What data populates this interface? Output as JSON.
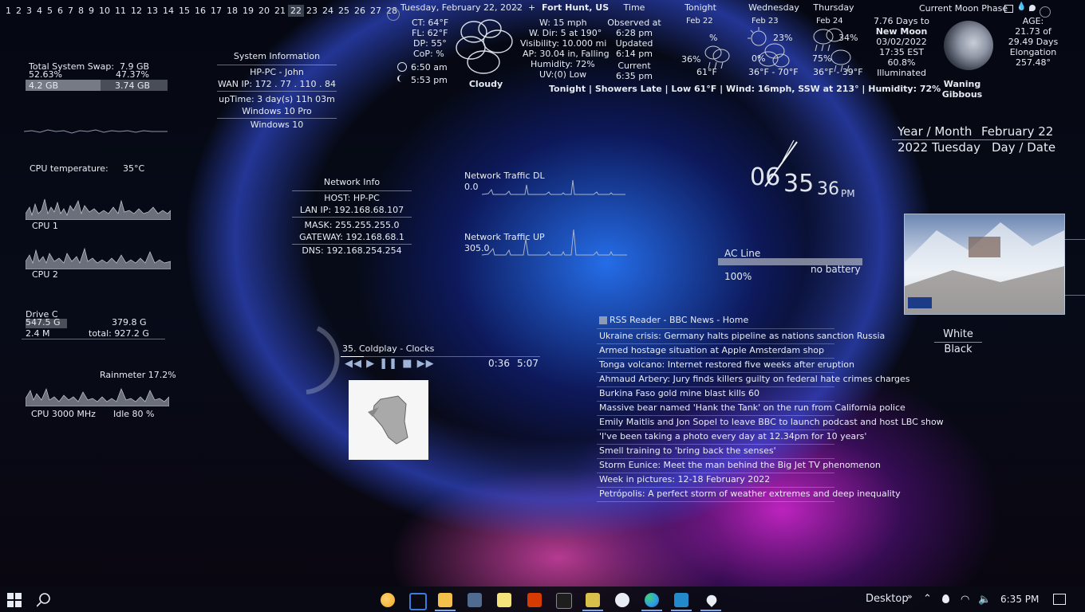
{
  "calendar": {
    "days": [
      "1",
      "2",
      "3",
      "4",
      "5",
      "6",
      "7",
      "8",
      "9",
      "10",
      "11",
      "12",
      "13",
      "14",
      "15",
      "16",
      "17",
      "18",
      "19",
      "20",
      "21",
      "22",
      "23",
      "24",
      "25",
      "26",
      "27",
      "28"
    ],
    "current_index": 21
  },
  "swap": {
    "title": "Total System Swap:",
    "total": "7.9 GB",
    "used_pct": "52.63%",
    "free_pct": "47.37%",
    "used_gb": "4.2 GB",
    "free_gb": "3.74 GB",
    "used_fraction": 0.526
  },
  "sysinfo": {
    "title": "System Information",
    "user": "HP-PC - John",
    "wan_ip": "WAN IP: 172 . 77 . 110 . 84",
    "uptime": "upTime: 3 day(s) 11h 03m",
    "os1": "Windows 10 Pro",
    "os2": "Windows 10"
  },
  "cpu": {
    "temp_label": "CPU temperature:",
    "temp_value": "35°C",
    "cpu1": "CPU 1",
    "cpu2": "CPU 2",
    "rainmeter": "Rainmeter 17.2%",
    "freq": "CPU 3000 MHz",
    "idle": "Idle 80 %"
  },
  "drive": {
    "name": "Drive C",
    "used": "547.5 G",
    "free": "379.8 G",
    "io": "2.4 M",
    "total": "total: 927.2 G",
    "used_fraction": 0.59
  },
  "network": {
    "title": "Network Info",
    "host": "HOST: HP-PC",
    "lan": "LAN IP: 192.168.68.107",
    "mask": "MASK: 255.255.255.0",
    "gateway": "GATEWAY: 192.168.68.1",
    "dns": "DNS: 192.168.254.254"
  },
  "traffic": {
    "dl_title": "Network Traffic DL",
    "dl_value": "0.0",
    "up_title": "Network Traffic UP",
    "up_value": "305.0"
  },
  "media": {
    "track": "35. Coldplay - Clocks",
    "position": "0:36",
    "duration": "5:07",
    "progress_fraction": 0.117
  },
  "weather": {
    "date": "Tuesday, February 22, 2022",
    "minus": "-",
    "plus": "+",
    "location": "Fort Hunt, US",
    "ct": "CT: 64°F",
    "fl": "FL: 62°F",
    "dp": "DP: 55°",
    "cop": "CoP: %",
    "sunrise": "6:50 am",
    "sunset": "5:53 pm",
    "condition": "Cloudy",
    "wind": "W: 15 mph",
    "wdir": "W. Dir: 5 at 190°",
    "visibility": "Visibility: 10.000 mi",
    "ap": "AP: 30.04 in, Falling",
    "humidity": "Humidity: 72%",
    "uv": "UV:(0) Low",
    "time_title": "Time",
    "observed": "Observed at",
    "observed_time": "6:28 pm",
    "updated": "Updated",
    "updated_time": "6:14 pm",
    "current": "Current",
    "current_time": "6:35 pm",
    "summary": "Tonight | Showers Late | Low 61°F | Wind: 16mph, SSW at 213° | Humidity: 72%"
  },
  "forecast": [
    {
      "title": "Tonight",
      "date": "Feb 22",
      "pct": "%",
      "pct2": "36%",
      "temp": "61°F"
    },
    {
      "title": "Wednesday",
      "date": "Feb 23",
      "pct": "23%",
      "pct2": "0%",
      "temp": "36°F - 70°F"
    },
    {
      "title": "Thursday",
      "date": "Feb 24",
      "pct": "34%",
      "pct2": "75%",
      "temp": "36°F - 39°F"
    }
  ],
  "moon": {
    "title": "Current Moon Phase",
    "days_to": "7.76 Days to",
    "next": "New Moon",
    "date": "03/02/2022",
    "time": "17:35 EST",
    "illum": "60.8%",
    "illum_label": "Illuminated",
    "age_label": "AGE:",
    "age": "21.73 of",
    "cycle": "29.49 Days",
    "elong_label": "Elongation",
    "elong": "257.48°",
    "phase": "Waning Gibbous"
  },
  "datebox": {
    "yearmonth_label": "Year / Month",
    "month_day": "February 22",
    "year_weekday": "2022 Tuesday",
    "daydate_label": "Day / Date"
  },
  "clock": {
    "hour": "06",
    "minute": "35",
    "second": "36",
    "ampm": "PM"
  },
  "power": {
    "source": "AC Line",
    "status": "no battery",
    "percent": "100%",
    "level_fraction": 1.0
  },
  "image_widget": {
    "label1": "White",
    "label2": "Black"
  },
  "rss": {
    "title": "RSS Reader - BBC News - Home",
    "items": [
      "Ukraine crisis: Germany halts pipeline as nations sanction Russia",
      "Armed hostage situation at Apple Amsterdam shop",
      "Tonga volcano: Internet restored five weeks after eruption",
      "Ahmaud Arbery: Jury finds killers guilty on federal hate crimes charges",
      "Burkina Faso gold mine blast kills 60",
      "Massive bear named 'Hank the Tank' on the run from California police",
      "Emily Maitlis and Jon Sopel to leave BBC to launch podcast and host LBC show",
      "'I've been taking a photo every day at 12.34pm for 10 years'",
      "Smell training to 'bring back the senses'",
      "Storm Eunice: Meet the man behind the Big Jet TV phenomenon",
      "Week in pictures: 12-18 February 2022",
      "Petrópolis: A perfect storm of weather extremes and deep inequality"
    ]
  },
  "taskbar": {
    "desktop": "Desktop",
    "desktop_arrow": "»",
    "time": "6:35 PM",
    "colors": {
      "accent": "#7aa6e8",
      "folder": "#f3c14b",
      "office": "#d83b01",
      "edge": "#2f9be6",
      "vscode": "#2489ca"
    }
  }
}
